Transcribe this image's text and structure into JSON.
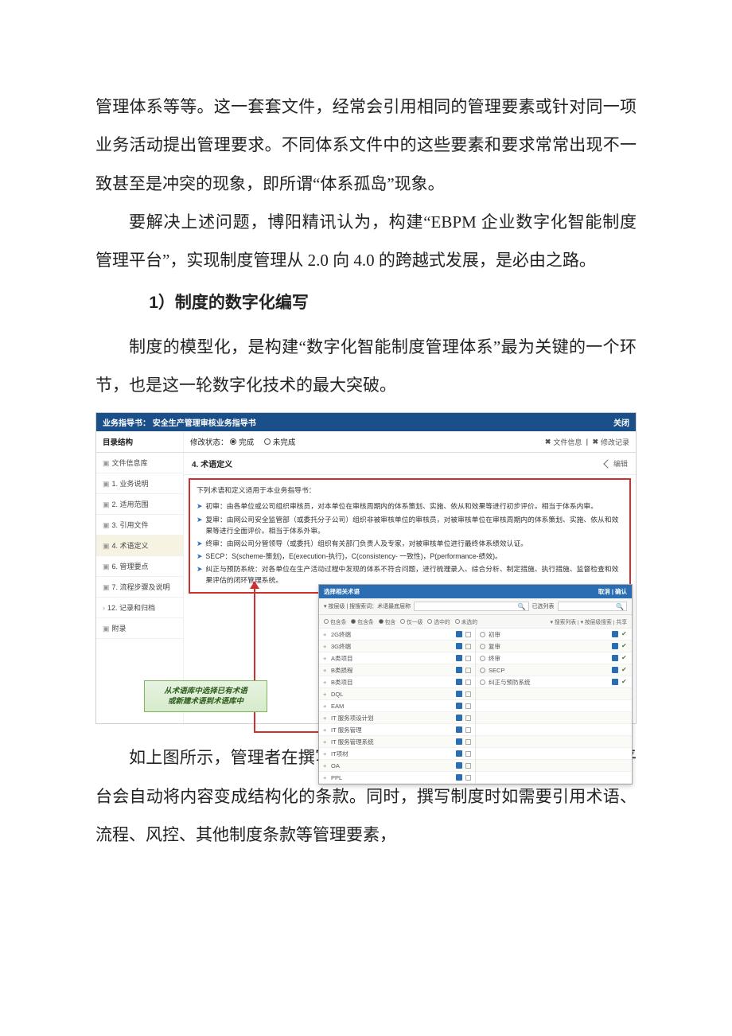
{
  "paragraphs": {
    "p1": "管理体系等等。这一套套文件，经常会引用相同的管理要素或针对同一项业务活动提出管理要求。不同体系文件中的这些要素和要求常常出现不一致甚至是冲突的现象，即所谓“体系孤岛”现象。",
    "p2": "要解决上述问题，博阳精讯认为，构建“EBPM 企业数字化智能制度管理平台”，实现制度管理从 2.0 向 4.0 的跨越式发展，是必由之路。",
    "h1": "1）制度的数字化编写",
    "p3": "制度的模型化，是构建“数字化智能制度管理体系”最为关键的一个环节，也是这一轮数字化技术的最大突破。",
    "p4": "如上图所示，管理者在撰写时感觉就像在写文本化制度，但数字化平台会自动将内容变成结构化的条款。同时，撰写制度时如需要引用术语、流程、风控、其他制度条款等管理要素，"
  },
  "embed": {
    "title_prefix": "业务指导书：",
    "title_main": "安全生产管理审核业务指导书",
    "close": "关闭",
    "toc_label": "目录结构",
    "status_label": "修改状态：",
    "status_done": "完成",
    "status_undone": "未完成",
    "file_info": "文件信息",
    "change_log": "修改记录",
    "toc": [
      "文件信息库",
      "1. 业务说明",
      "2. 适用范围",
      "3. 引用文件",
      "4. 术语定义",
      "6. 管理要点",
      "7. 流程步骤及说明",
      "12. 记录和归档",
      "附录"
    ],
    "section_title": "4. 术语定义",
    "edit": "编辑",
    "intro_line": "下列术语和定义适用于本业务指导书：",
    "terms": [
      "初审：由各单位或公司组织审核员，对本单位在审核周期内的体系策划、实施、依从和效果等进行初步评价。相当于体系内审。",
      "复审：由网公司安全监管部（或委托分子公司）组织非被审核单位的审核员，对被审核单位在审核周期内的体系策划、实施、依从和效果等进行全面评价。相当于体系外审。",
      "终审：由网公司分管领导（或委托）组织有关部门负责人及专家，对被审核单位进行最终体系绩效认证。",
      "SECP：S(scheme-策划)，E(execution-执行)，C(consistency- 一致性)，P(performance-绩效)。",
      "纠正与预防系统：对各单位在生产活动过程中发现的体系不符合问题，进行梳理录入、综合分析、制定措施、执行措施、监督检查和效果评估的闭环管理系统。"
    ],
    "green_tip_l1": "从术语库中选择已有术语",
    "green_tip_l2": "或新建术语到术语库中"
  },
  "dialog": {
    "title": "选择相关术语",
    "btns": "取消 | 确认",
    "tabs": "▾ 按层级 | 搜搜索词：术语最底层称",
    "right_tab": "已选列表",
    "filters": [
      "包含条",
      "包含条",
      "包含",
      "仅一级",
      "选中的",
      "未选的"
    ],
    "right_filters": "▾ 搜索列表 | ▾ 按层级搜索 | 共享",
    "left_items": [
      "2G终端",
      "3G终端",
      "A类项目",
      "B类损程",
      "B类项目",
      "DQL",
      "EAM",
      "IT 服务项设计划",
      "IT 服务管理",
      "IT 服务管理系统",
      "IT项材",
      "OA",
      "PPL"
    ],
    "right_items": [
      "初审",
      "复审",
      "终审",
      "SECP",
      "纠正与预防系统"
    ]
  }
}
